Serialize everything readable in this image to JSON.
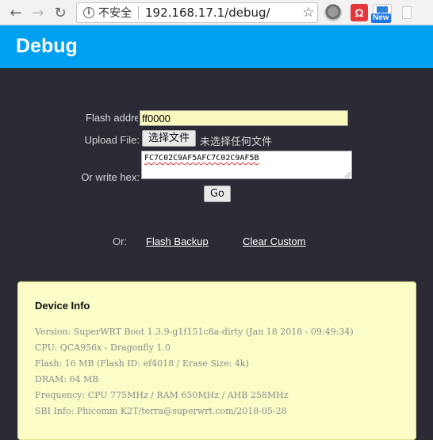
{
  "browser": {
    "security_label": "不安全",
    "url": "192.168.17.1/debug/",
    "nav": {
      "back_icon": "←",
      "forward_icon": "→",
      "reload_icon": "↻",
      "star_icon": "☆"
    },
    "extensions": {
      "ext2_glyph": "Ω",
      "ext3_badge": "New"
    }
  },
  "header": {
    "title": "Debug",
    "background_color": "#00a0f0"
  },
  "form": {
    "flash_address_label": "Flash address",
    "flash_address_value": "ff0000",
    "upload_label": "Upload File:",
    "file_button_label": "选择文件",
    "file_status": "未选择任何文件",
    "hex_label": "Or write hex:",
    "hex_value": "FC7C02C9AF5AFC7C02C9AF5B",
    "go_button_label": "Go"
  },
  "links": {
    "or_label": "Or:",
    "flash_backup": "Flash Backup",
    "clear_custom": "Clear Custom"
  },
  "device_info": {
    "title": "Device Info",
    "lines": [
      "Version: SuperWRT Boot 1.3.9-g1f151c8a-dirty (Jan 18 2018 - 09:49:34)",
      "CPU: QCA956x - Dragonfly 1.0",
      "Flash: 16 MB (Flash ID: ef4018 / Erase Size: 4k)",
      "DRAM: 64 MB",
      "Frequency: CPU 775MHz / RAM 650MHz / AHB 258MHz",
      "SBI Info: Phicomm K2T/terra@superwrt.com/2018-05-28"
    ]
  }
}
